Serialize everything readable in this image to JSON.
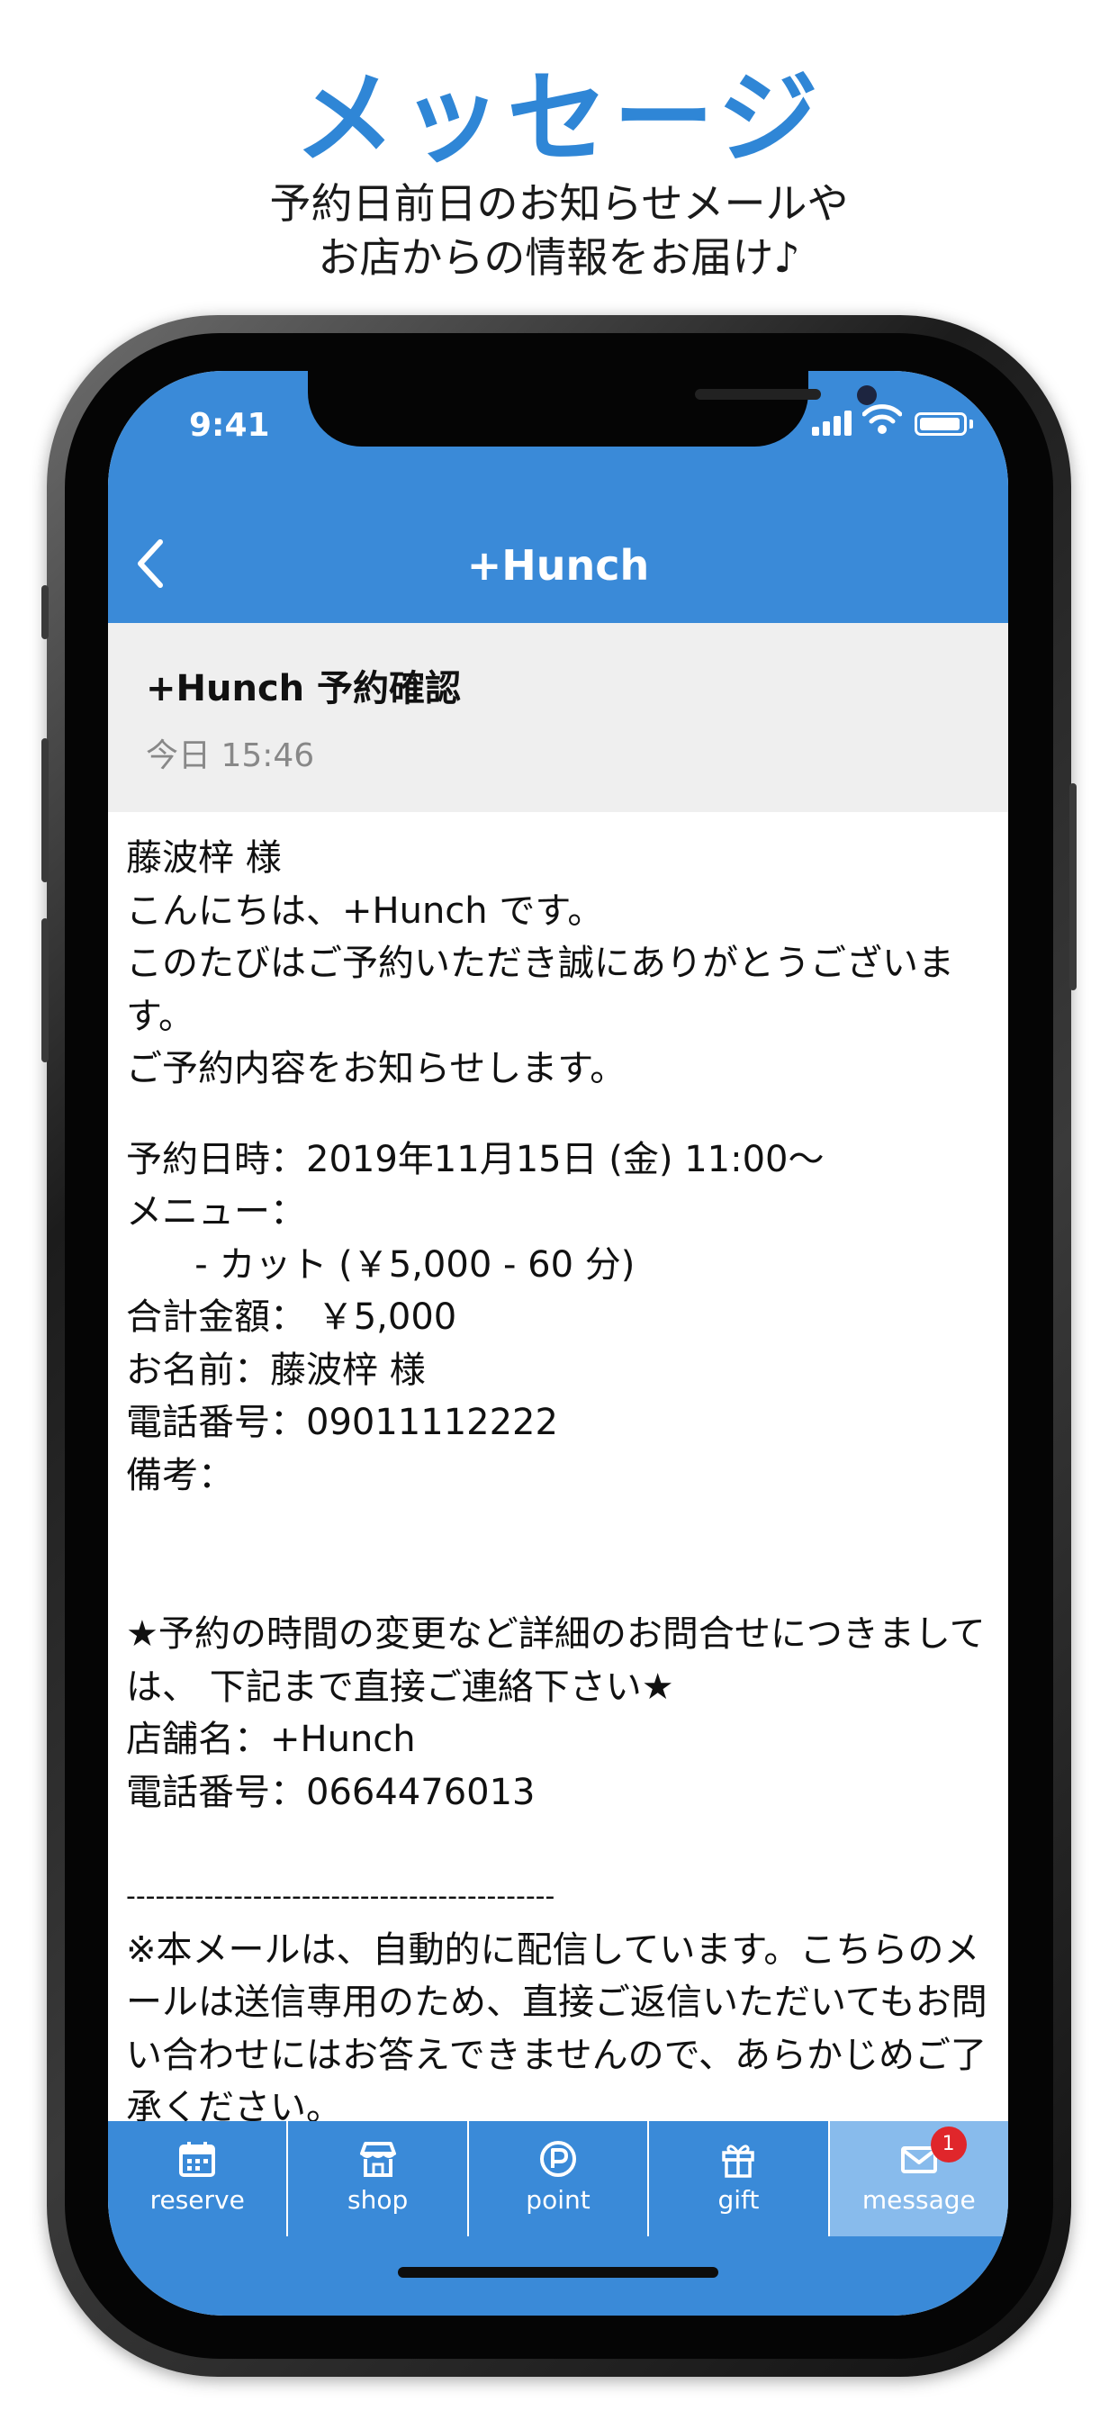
{
  "promo": {
    "title": "メッセージ",
    "subtitle_line1": "予約日前日のお知らせメールや",
    "subtitle_line2": "お店からの情報をお届け♪"
  },
  "status_bar": {
    "time": "9:41",
    "icons": [
      "signal-icon",
      "wifi-icon",
      "battery-icon"
    ]
  },
  "nav": {
    "title": "+Hunch",
    "back_icon": "chevron-left-icon"
  },
  "message": {
    "subject": "+Hunch 予約確認",
    "date": "今日 15:46",
    "body": {
      "greeting_name": "藤波梓 様",
      "hello": "こんにちは、+Hunch です。",
      "thanks": "このたびはご予約いただき誠にありがとうございます。",
      "notice": "ご予約内容をお知らせします。",
      "datetime": "予約日時：2019年11月15日 (金) 11:00〜",
      "menu_label": "メニュー：",
      "menu_item": "      - カット (￥5,000 - 60 分)",
      "total": "合計金額： ￥5,000",
      "name": "お名前：藤波梓 様",
      "phone": "電話番号：09011112222",
      "remarks": "備考：",
      "contact_note": "★予約の時間の変更など詳細のお問合せにつきましては、 下記まで直接ご連絡下さい★",
      "shop_name": "店舗名：+Hunch",
      "shop_phone": "電話番号：0664476013",
      "divider": "--------------------------------------------",
      "disclaimer": "※本メールは、自動的に配信しています。こちらのメールは送信専用のため、直接ご返信いただいてもお問い合わせにはお答えできませんので、あらかじめご了承ください。"
    }
  },
  "tabs": [
    {
      "label": "reserve",
      "icon": "calendar-icon",
      "active": false
    },
    {
      "label": "shop",
      "icon": "storefront-icon",
      "active": false
    },
    {
      "label": "point",
      "icon": "point-coin-icon",
      "active": false
    },
    {
      "label": "gift",
      "icon": "gift-icon",
      "active": false
    },
    {
      "label": "message",
      "icon": "envelope-icon",
      "active": true,
      "badge": "1"
    }
  ],
  "colors": {
    "accent": "#3a8ad8",
    "title_blue": "#2f86d6",
    "active_tab": "#88bbec",
    "badge_red": "#e0262b",
    "header_gray": "#efefef"
  }
}
